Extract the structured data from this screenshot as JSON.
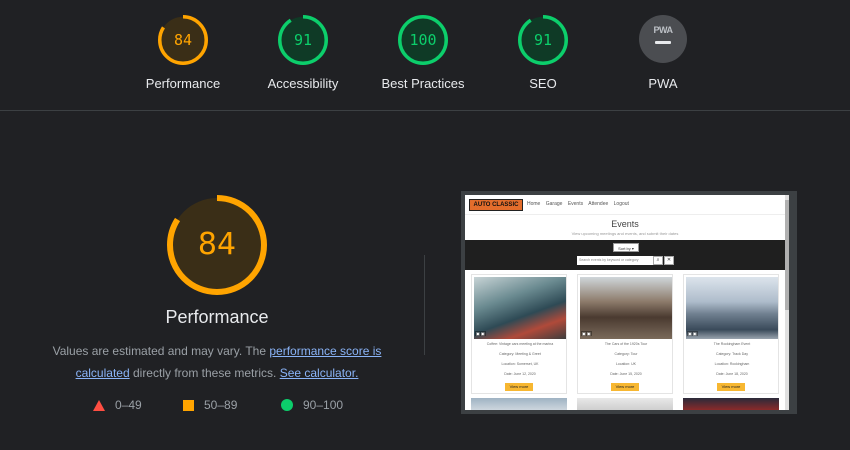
{
  "top_scores": [
    {
      "label": "Performance",
      "score": "84",
      "value": 84,
      "color": "#ffa400",
      "track": "#3a2e17"
    },
    {
      "label": "Accessibility",
      "score": "91",
      "value": 91,
      "color": "#0cce6b",
      "track": "#0f3a26"
    },
    {
      "label": "Best Practices",
      "score": "100",
      "value": 100,
      "color": "#0cce6b",
      "track": "#0f3a26"
    },
    {
      "label": "SEO",
      "score": "91",
      "value": 91,
      "color": "#0cce6b",
      "track": "#0f3a26"
    },
    {
      "label": "PWA",
      "badge_text": "PWA"
    }
  ],
  "performance": {
    "score": "84",
    "value": 84,
    "color": "#ffa400",
    "title": "Performance",
    "desc_prefix": "Values are estimated and may vary. The ",
    "link_score": "performance score is calculated",
    "desc_mid": " directly from these metrics. ",
    "link_calc": "See calculator."
  },
  "legend": [
    {
      "range": "0–49",
      "icon": "fail-triangle-icon",
      "color": "#ff4e42"
    },
    {
      "range": "50–89",
      "icon": "average-square-icon",
      "color": "#ffa400"
    },
    {
      "range": "90–100",
      "icon": "pass-circle-icon",
      "color": "#0cce6b"
    }
  ],
  "screenshot": {
    "logo": "AUTO CLASSIC",
    "nav": [
      "Home",
      "Garage",
      "Events",
      "Attendee",
      "Logout"
    ],
    "page_title": "Events",
    "page_subtitle": "View upcoming meetings and events, and submit their dates",
    "sort_label": "Sort by ▾",
    "search_placeholder": "Search events by keyword or category",
    "search_btn": "⌕",
    "clear_btn": "✕",
    "cards": [
      {
        "title": "Coffee: Vintage cars meeting at the marina",
        "category": "Category: Meeting & Greet",
        "location": "Location: Somerset, UK",
        "date": "Date: June 12, 2020",
        "more": "View more"
      },
      {
        "title": "The Cars of the 1920s Tour",
        "category": "Category: Tour",
        "location": "Location: UK",
        "date": "Date: June 15, 2020",
        "more": "View more"
      },
      {
        "title": "The Rockingham Event",
        "category": "Category: Track Day",
        "location": "Location: Rockingham",
        "date": "Date: June 18, 2020",
        "more": "View more"
      }
    ]
  }
}
